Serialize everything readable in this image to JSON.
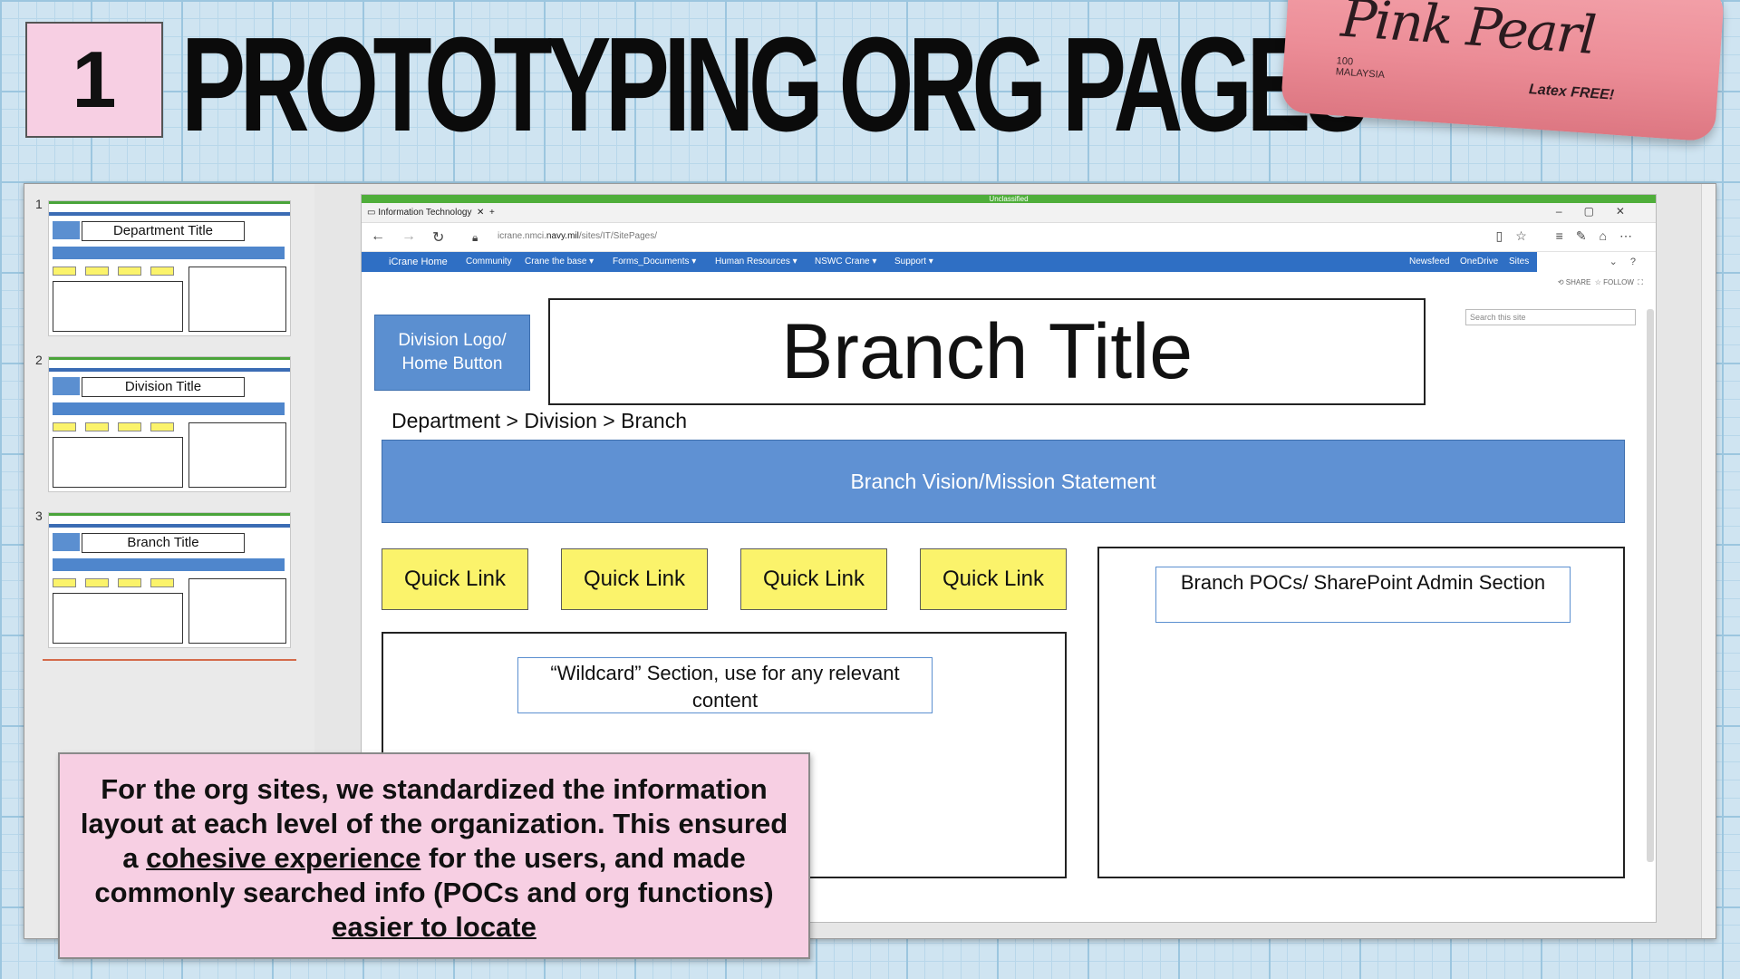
{
  "slide_number": "1",
  "slide_heading": "PROTOTYPING ORG PAGES",
  "eraser": {
    "brand": "Pink Pearl",
    "number": "100",
    "country": "MALAYSIA",
    "latex": "Latex FREE!"
  },
  "thumbnails": [
    {
      "num": "1",
      "title": "Department Title"
    },
    {
      "num": "2",
      "title": "Division Title"
    },
    {
      "num": "3",
      "title": "Branch Title"
    }
  ],
  "browser": {
    "classification": "Unclassified",
    "tab_label": "Information Technology",
    "url_prefix": "icrane.nmci.",
    "url_domain": "navy.mil",
    "url_path": "/sites/IT/SitePages/",
    "nav_items": [
      "iCrane Home",
      "Community",
      "Crane the base ▾",
      "Forms_Documents ▾",
      "Human Resources ▾",
      "NSWC Crane ▾",
      "Support ▾"
    ],
    "nav_right_items": [
      "Newsfeed",
      "OneDrive",
      "Sites"
    ],
    "share_label": "SHARE",
    "follow_label": "FOLLOW",
    "search_placeholder": "Search this site"
  },
  "mockup": {
    "logo_button": "Division Logo/ Home Button",
    "title": "Branch Title",
    "breadcrumb": "Department > Division > Branch",
    "mission": "Branch Vision/Mission Statement",
    "quick_links": [
      "Quick Link",
      "Quick Link",
      "Quick Link",
      "Quick Link"
    ],
    "wildcard": "“Wildcard” Section, use for any relevant content",
    "poc": "Branch POCs/ SharePoint Admin Section"
  },
  "note": {
    "part1": "For the org sites, we standardized the information layout at each level of the organization. This ensured a ",
    "link1": "cohesive experience",
    "part2": " for the users, and made commonly searched info (POCs and org functions) ",
    "link2": "easier to locate"
  },
  "colors": {
    "accent_blue": "#5f91d3",
    "quick_link_yellow": "#fbf36b",
    "pink_note": "#f7cfe3",
    "classification_green": "#4fae3a"
  }
}
